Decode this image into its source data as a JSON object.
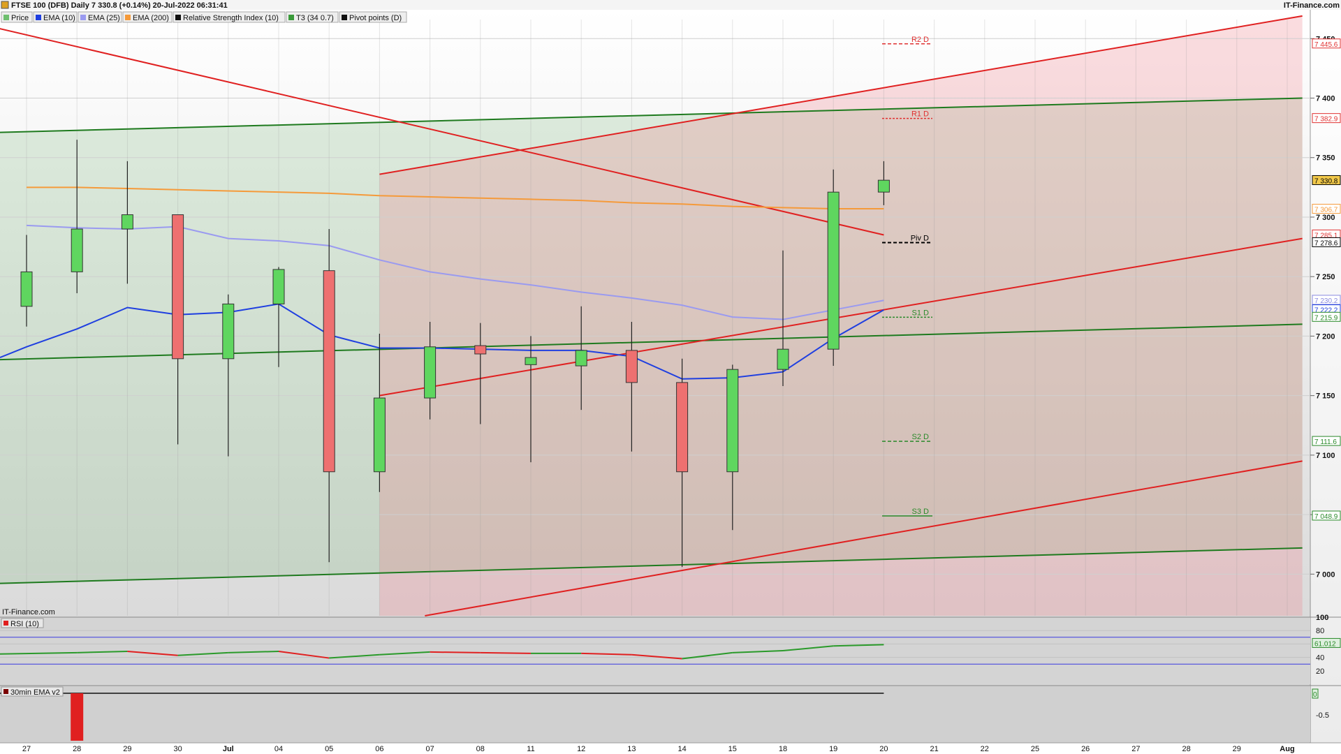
{
  "header": {
    "title": "FTSE 100 (DFB) Daily 7 330.8 (+0.14%) 20-Jul-2022 06:31:41",
    "brand": "IT-Finance.com",
    "watermark": "IT-Finance.com"
  },
  "legend": [
    {
      "label": "Price",
      "color": "#6fbf6f"
    },
    {
      "label": "EMA (10)",
      "color": "#1f3fe0"
    },
    {
      "label": "EMA (25)",
      "color": "#9a9af0"
    },
    {
      "label": "EMA (200)",
      "color": "#f59a3a"
    },
    {
      "label": "Relative Strength Index (10)",
      "color": "#111111"
    },
    {
      "label": "T3 (34 0.7)",
      "color": "#3a9a3a"
    },
    {
      "label": "Pivot points (D)",
      "color": "#111111"
    }
  ],
  "chart_data": {
    "type": "candlestick",
    "dates": [
      "27",
      "28",
      "29",
      "30",
      "Jul",
      "04",
      "05",
      "06",
      "07",
      "08",
      "11",
      "12",
      "13",
      "14",
      "15",
      "18",
      "19",
      "20"
    ],
    "x_axis_labels": [
      "27",
      "28",
      "29",
      "30",
      "Jul",
      "04",
      "05",
      "06",
      "07",
      "08",
      "11",
      "12",
      "13",
      "14",
      "15",
      "18",
      "19",
      "20",
      "21",
      "22",
      "25",
      "26",
      "27",
      "28",
      "29",
      "Aug"
    ],
    "ohlc": [
      {
        "o": 7225,
        "h": 7285,
        "l": 7208,
        "c": 7254
      },
      {
        "o": 7254,
        "h": 7365,
        "l": 7236,
        "c": 7290
      },
      {
        "o": 7290,
        "h": 7347,
        "l": 7244,
        "c": 7302
      },
      {
        "o": 7302,
        "h": 7302,
        "l": 7109,
        "c": 7181
      },
      {
        "o": 7181,
        "h": 7235,
        "l": 7099,
        "c": 7227
      },
      {
        "o": 7227,
        "h": 7258,
        "l": 7174,
        "c": 7256
      },
      {
        "o": 7255,
        "h": 7290,
        "l": 7010,
        "c": 7086
      },
      {
        "o": 7086,
        "h": 7202,
        "l": 7069,
        "c": 7148
      },
      {
        "o": 7148,
        "h": 7212,
        "l": 7130,
        "c": 7191
      },
      {
        "o": 7192,
        "h": 7211,
        "l": 7126,
        "c": 7185
      },
      {
        "o": 7176,
        "h": 7200,
        "l": 7094,
        "c": 7182
      },
      {
        "o": 7175,
        "h": 7225,
        "l": 7138,
        "c": 7188
      },
      {
        "o": 7188,
        "h": 7212,
        "l": 7103,
        "c": 7161
      },
      {
        "o": 7161,
        "h": 7181,
        "l": 7006,
        "c": 7086
      },
      {
        "o": 7086,
        "h": 7176,
        "l": 7037,
        "c": 7172
      },
      {
        "o": 7172,
        "h": 7272,
        "l": 7158,
        "c": 7189
      },
      {
        "o": 7189,
        "h": 7340,
        "l": 7175,
        "c": 7321
      },
      {
        "o": 7321,
        "h": 7347,
        "l": 7310,
        "c": 7331
      }
    ],
    "ema10": [
      7182,
      7191,
      7206,
      7224,
      7218,
      7220,
      7227,
      7201,
      7190,
      7190,
      7189,
      7188,
      7188,
      7183,
      7164,
      7165,
      7170,
      7198,
      7222
    ],
    "ema25": [
      7293,
      7291,
      7290,
      7292,
      7282,
      7280,
      7276,
      7264,
      7254,
      7248,
      7243,
      7237,
      7232,
      7226,
      7216,
      7214,
      7222,
      7230
    ],
    "ema200": [
      7325,
      7325,
      7324,
      7323,
      7322,
      7321,
      7320,
      7318,
      7317,
      7316,
      7315,
      7314,
      7312,
      7311,
      7309,
      7308,
      7307,
      7307
    ],
    "y_ticks": [
      7000,
      7050,
      7100,
      7150,
      7200,
      7250,
      7300,
      7350,
      7400,
      7450
    ],
    "y_tick_labels": [
      "7 000",
      "",
      "7 100",
      "7 150",
      "7 200",
      "7 250",
      "7 300",
      "7 350",
      "7 400",
      "7 450"
    ],
    "price_tags": [
      {
        "value": 7445.6,
        "label": "7 445.6",
        "color": "#e03030",
        "fill": "#ffffff"
      },
      {
        "value": 7382.9,
        "label": "7 382.9",
        "color": "#e03030",
        "fill": "#ffffff"
      },
      {
        "value": 7330.8,
        "label": "7 330.8",
        "color": "#000000",
        "fill": "#f2c94a"
      },
      {
        "value": 7306.7,
        "label": "7 306.7",
        "color": "#f59a3a",
        "fill": "#ffffff"
      },
      {
        "value": 7285.1,
        "label": "7 285.1",
        "color": "#e03030",
        "fill": "#ffffff"
      },
      {
        "value": 7278.6,
        "label": "7 278.6",
        "color": "#000000",
        "fill": "#ffffff"
      },
      {
        "value": 7230.2,
        "label": "7 230.2",
        "color": "#8a8ae0",
        "fill": "#ffffff"
      },
      {
        "value": 7222.2,
        "label": "7 222.2",
        "color": "#1f3fe0",
        "fill": "#ffffff"
      },
      {
        "value": 7215.9,
        "label": "7 215.9",
        "color": "#2a8a2a",
        "fill": "#ffffff"
      },
      {
        "value": 7111.6,
        "label": "7 111.6",
        "color": "#2a8a2a",
        "fill": "#ffffff"
      },
      {
        "value": 7048.9,
        "label": "7 048.9",
        "color": "#2a8a2a",
        "fill": "#ffffff"
      }
    ],
    "pivots": [
      {
        "name": "R2 D",
        "value": 7445.6,
        "color": "#e03030",
        "style": "dashed"
      },
      {
        "name": "R1 D",
        "value": 7382.9,
        "color": "#e03030",
        "style": "dotted"
      },
      {
        "name": "Piv D",
        "value": 7278.6,
        "color": "#000000",
        "style": "dashed"
      },
      {
        "name": "S1 D",
        "value": 7215.9,
        "color": "#2a8a2a",
        "style": "dotted"
      },
      {
        "name": "S2 D",
        "value": 7111.6,
        "color": "#2a8a2a",
        "style": "dashed"
      },
      {
        "name": "S3 D",
        "value": 7048.9,
        "color": "#2a8a2a",
        "style": "solid"
      }
    ],
    "rsi": {
      "label": "RSI (10)",
      "values": [
        45,
        47,
        49,
        43,
        47,
        49,
        39,
        44,
        48,
        47,
        46,
        46,
        44,
        38,
        47,
        50,
        57,
        59
      ],
      "last_tag": "61.012",
      "ticks": [
        "100",
        "80",
        "60",
        "40",
        "20"
      ]
    },
    "ema30": {
      "label": "30min EMA v2",
      "ticks": [
        "0",
        "-0.5"
      ]
    }
  }
}
